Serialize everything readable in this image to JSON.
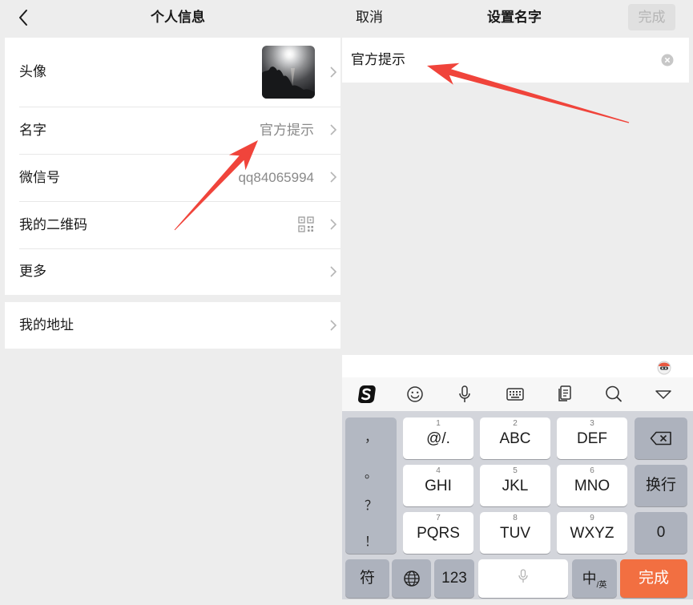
{
  "left": {
    "header": {
      "title": "个人信息"
    },
    "rows": [
      {
        "label": "头像"
      },
      {
        "label": "名字",
        "value": "官方提示"
      },
      {
        "label": "微信号",
        "value": "qq84065994"
      },
      {
        "label": "我的二维码"
      },
      {
        "label": "更多"
      }
    ],
    "address": {
      "label": "我的地址"
    }
  },
  "right": {
    "header": {
      "cancel": "取消",
      "title": "设置名字",
      "done": "完成"
    },
    "name_input": {
      "value": "官方提示"
    }
  },
  "keyboard": {
    "toolbar_icons": [
      "sogou-logo-icon",
      "emoji-icon",
      "microphone-icon",
      "keyboard-icon",
      "clipboard-icon",
      "search-icon",
      "collapse-keyboard-icon"
    ],
    "punctuation": [
      "，",
      "。",
      "？",
      "！"
    ],
    "keys": [
      {
        "num": "1",
        "label": "@/."
      },
      {
        "num": "2",
        "label": "ABC"
      },
      {
        "num": "3",
        "label": "DEF"
      },
      {
        "num": "4",
        "label": "GHI"
      },
      {
        "num": "5",
        "label": "JKL"
      },
      {
        "num": "6",
        "label": "MNO"
      },
      {
        "num": "7",
        "label": "PQRS"
      },
      {
        "num": "8",
        "label": "TUV"
      },
      {
        "num": "9",
        "label": "WXYZ"
      }
    ],
    "newline": "换行",
    "zero": "0",
    "symbols": "符",
    "numbers": "123",
    "lang_main": "中",
    "lang_alt": "/英",
    "done": "完成"
  },
  "icons": {
    "back": "chevron-left-icon",
    "row_arrow": "chevron-right-icon",
    "qr": "qr-code-icon",
    "clear": "clear-icon",
    "delete": "backspace-icon",
    "globe": "globe-icon",
    "space": "microphone-icon",
    "mascot": "mascot-icon"
  },
  "colors": {
    "page_background": "#ededed",
    "keyboard_background": "#d3d5db",
    "dark_key": "#adb2bd",
    "done_key": "#f26f41",
    "annotation_arrow": "#f0443b"
  }
}
